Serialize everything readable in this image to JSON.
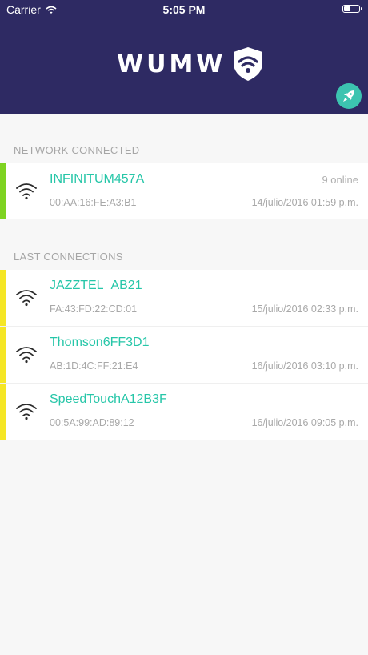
{
  "status_bar": {
    "carrier": "Carrier",
    "time": "5:05 PM",
    "battery_level": 0.4
  },
  "header": {
    "logo_text": "WUMW",
    "logo_icon": "shield-wifi-icon",
    "action_icon": "rocket-icon",
    "background_color": "#2e2a63",
    "accent_color": "#3cc4b0"
  },
  "connected_section": {
    "label": "NETWORK CONNECTED",
    "network": {
      "ssid": "INFINITUM457A",
      "mac": "00:AA:16:FE:A3:B1",
      "date": "14/julio/2016 01:59 p.m.",
      "online": "9 online",
      "status_color": "#7ed321"
    }
  },
  "last_section": {
    "label": "LAST CONNECTIONS",
    "status_color": "#f5e625",
    "networks": [
      {
        "ssid": "JAZZTEL_AB21",
        "mac": "FA:43:FD:22:CD:01",
        "date": "15/julio/2016 02:33 p.m."
      },
      {
        "ssid": "Thomson6FF3D1",
        "mac": "AB:1D:4C:FF:21:E4",
        "date": "16/julio/2016 03:10 p.m."
      },
      {
        "ssid": "SpeedTouchA12B3F",
        "mac": "00:5A:99:AD:89:12",
        "date": "16/julio/2016 09:05 p.m."
      }
    ]
  }
}
